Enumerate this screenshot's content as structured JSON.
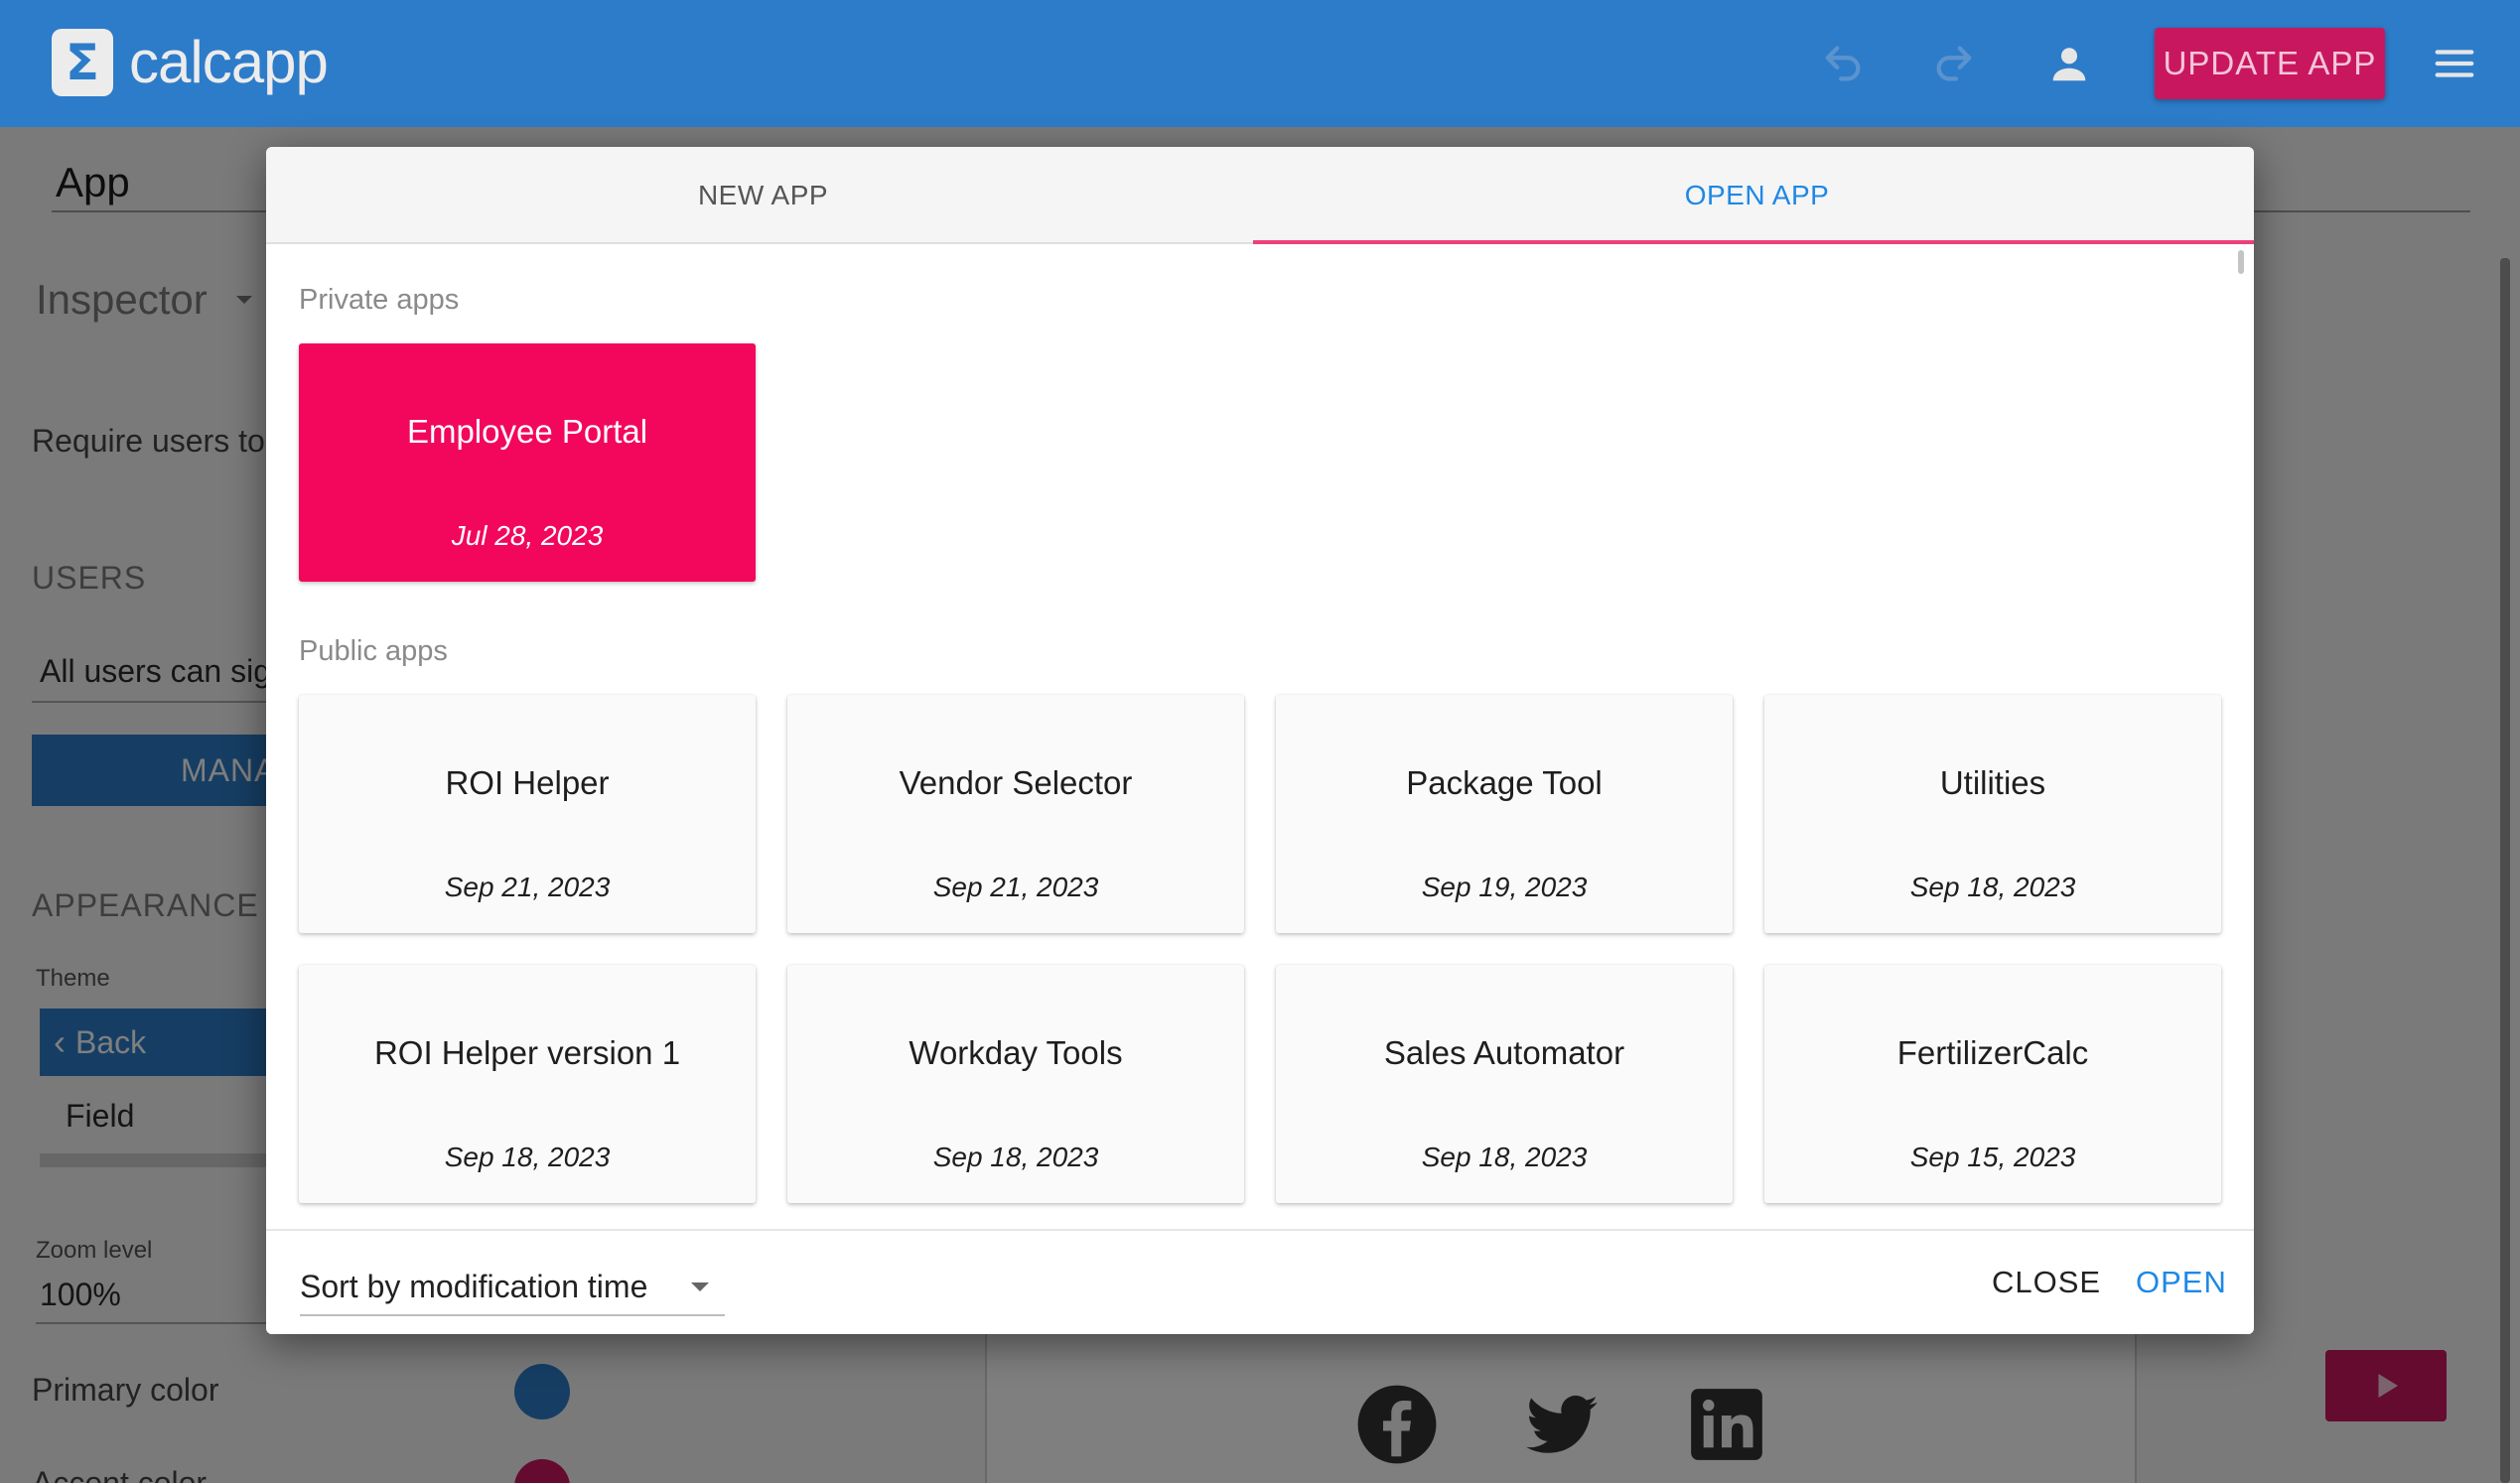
{
  "header": {
    "logo_symbol": "Σ",
    "app_name": "calcapp",
    "undo_icon": "undo-icon",
    "redo_icon": "redo-icon",
    "account_icon": "account-icon",
    "update_button": "UPDATE APP",
    "menu_icon": "hamburger-menu-icon"
  },
  "background": {
    "app_field_label": "App",
    "inspector_label": "Inspector",
    "require_users_text": "Require users to",
    "users_heading": "USERS",
    "users_select_value": "All users can sig",
    "manage_button": "MANA",
    "appearance_heading": "APPEARANCE",
    "theme_label": "Theme",
    "back_button": "Back",
    "field_label": "Field",
    "zoom_label": "Zoom level",
    "zoom_value": "100%",
    "primary_color_label": "Primary color",
    "accent_color_label": "Accent color",
    "primary_color": "#2d7cc9",
    "accent_color": "#c8175f"
  },
  "dialog": {
    "tabs": [
      {
        "label": "NEW APP",
        "active": false
      },
      {
        "label": "OPEN APP",
        "active": true
      }
    ],
    "private_heading": "Private apps",
    "private_apps": [
      {
        "name": "Employee Portal",
        "date": "Jul 28, 2023",
        "selected": true
      }
    ],
    "public_heading": "Public apps",
    "public_apps": [
      {
        "name": "ROI Helper",
        "date": "Sep 21, 2023"
      },
      {
        "name": "Vendor Selector",
        "date": "Sep 21, 2023"
      },
      {
        "name": "Package Tool",
        "date": "Sep 19, 2023"
      },
      {
        "name": "Utilities",
        "date": "Sep 18, 2023"
      },
      {
        "name": "ROI Helper version 1",
        "date": "Sep 18, 2023"
      },
      {
        "name": "Workday Tools",
        "date": "Sep 18, 2023"
      },
      {
        "name": "Sales Automator",
        "date": "Sep 18, 2023"
      },
      {
        "name": "FertilizerCalc",
        "date": "Sep 15, 2023"
      }
    ],
    "sort_value": "Sort by modification time",
    "close_button": "CLOSE",
    "open_button": "OPEN",
    "selected_color": "#f2075c",
    "accent_blue": "#1e88e5",
    "tab_indicator_color": "#ec407a"
  }
}
